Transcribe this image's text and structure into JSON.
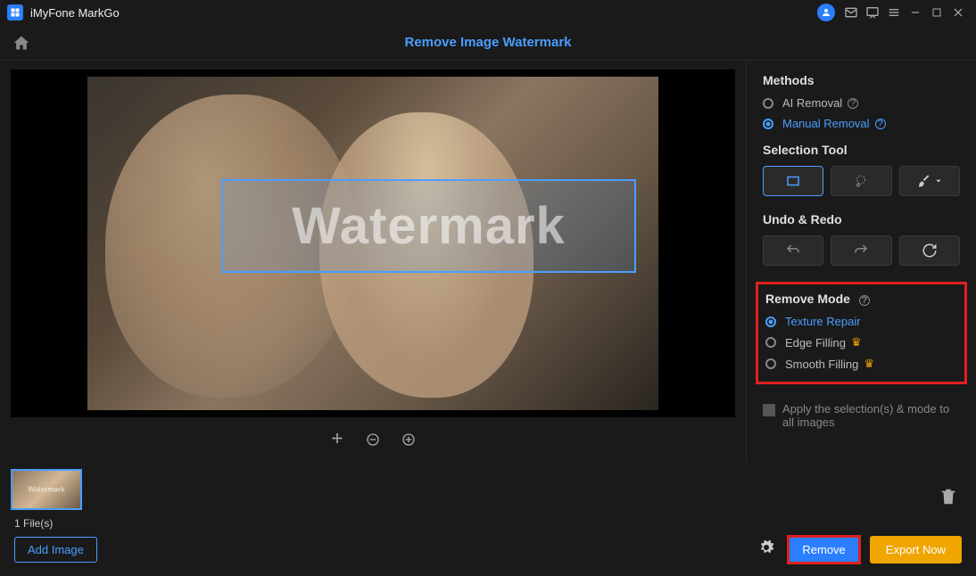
{
  "app": {
    "title": "iMyFone MarkGo"
  },
  "page": {
    "title": "Remove Image Watermark"
  },
  "watermark": {
    "text": "Watermark"
  },
  "methods": {
    "heading": "Methods",
    "ai": "AI Removal",
    "manual": "Manual Removal",
    "selected": "manual"
  },
  "selection_tool": {
    "heading": "Selection Tool"
  },
  "undo_redo": {
    "heading": "Undo & Redo"
  },
  "remove_mode": {
    "heading": "Remove Mode",
    "texture": "Texture Repair",
    "edge": "Edge Filling",
    "smooth": "Smooth Filling",
    "selected": "texture"
  },
  "apply_all": {
    "label": "Apply the selection(s) & mode to all images"
  },
  "files": {
    "count_label": "1 File(s)"
  },
  "buttons": {
    "add_image": "Add Image",
    "remove": "Remove",
    "export": "Export Now"
  }
}
